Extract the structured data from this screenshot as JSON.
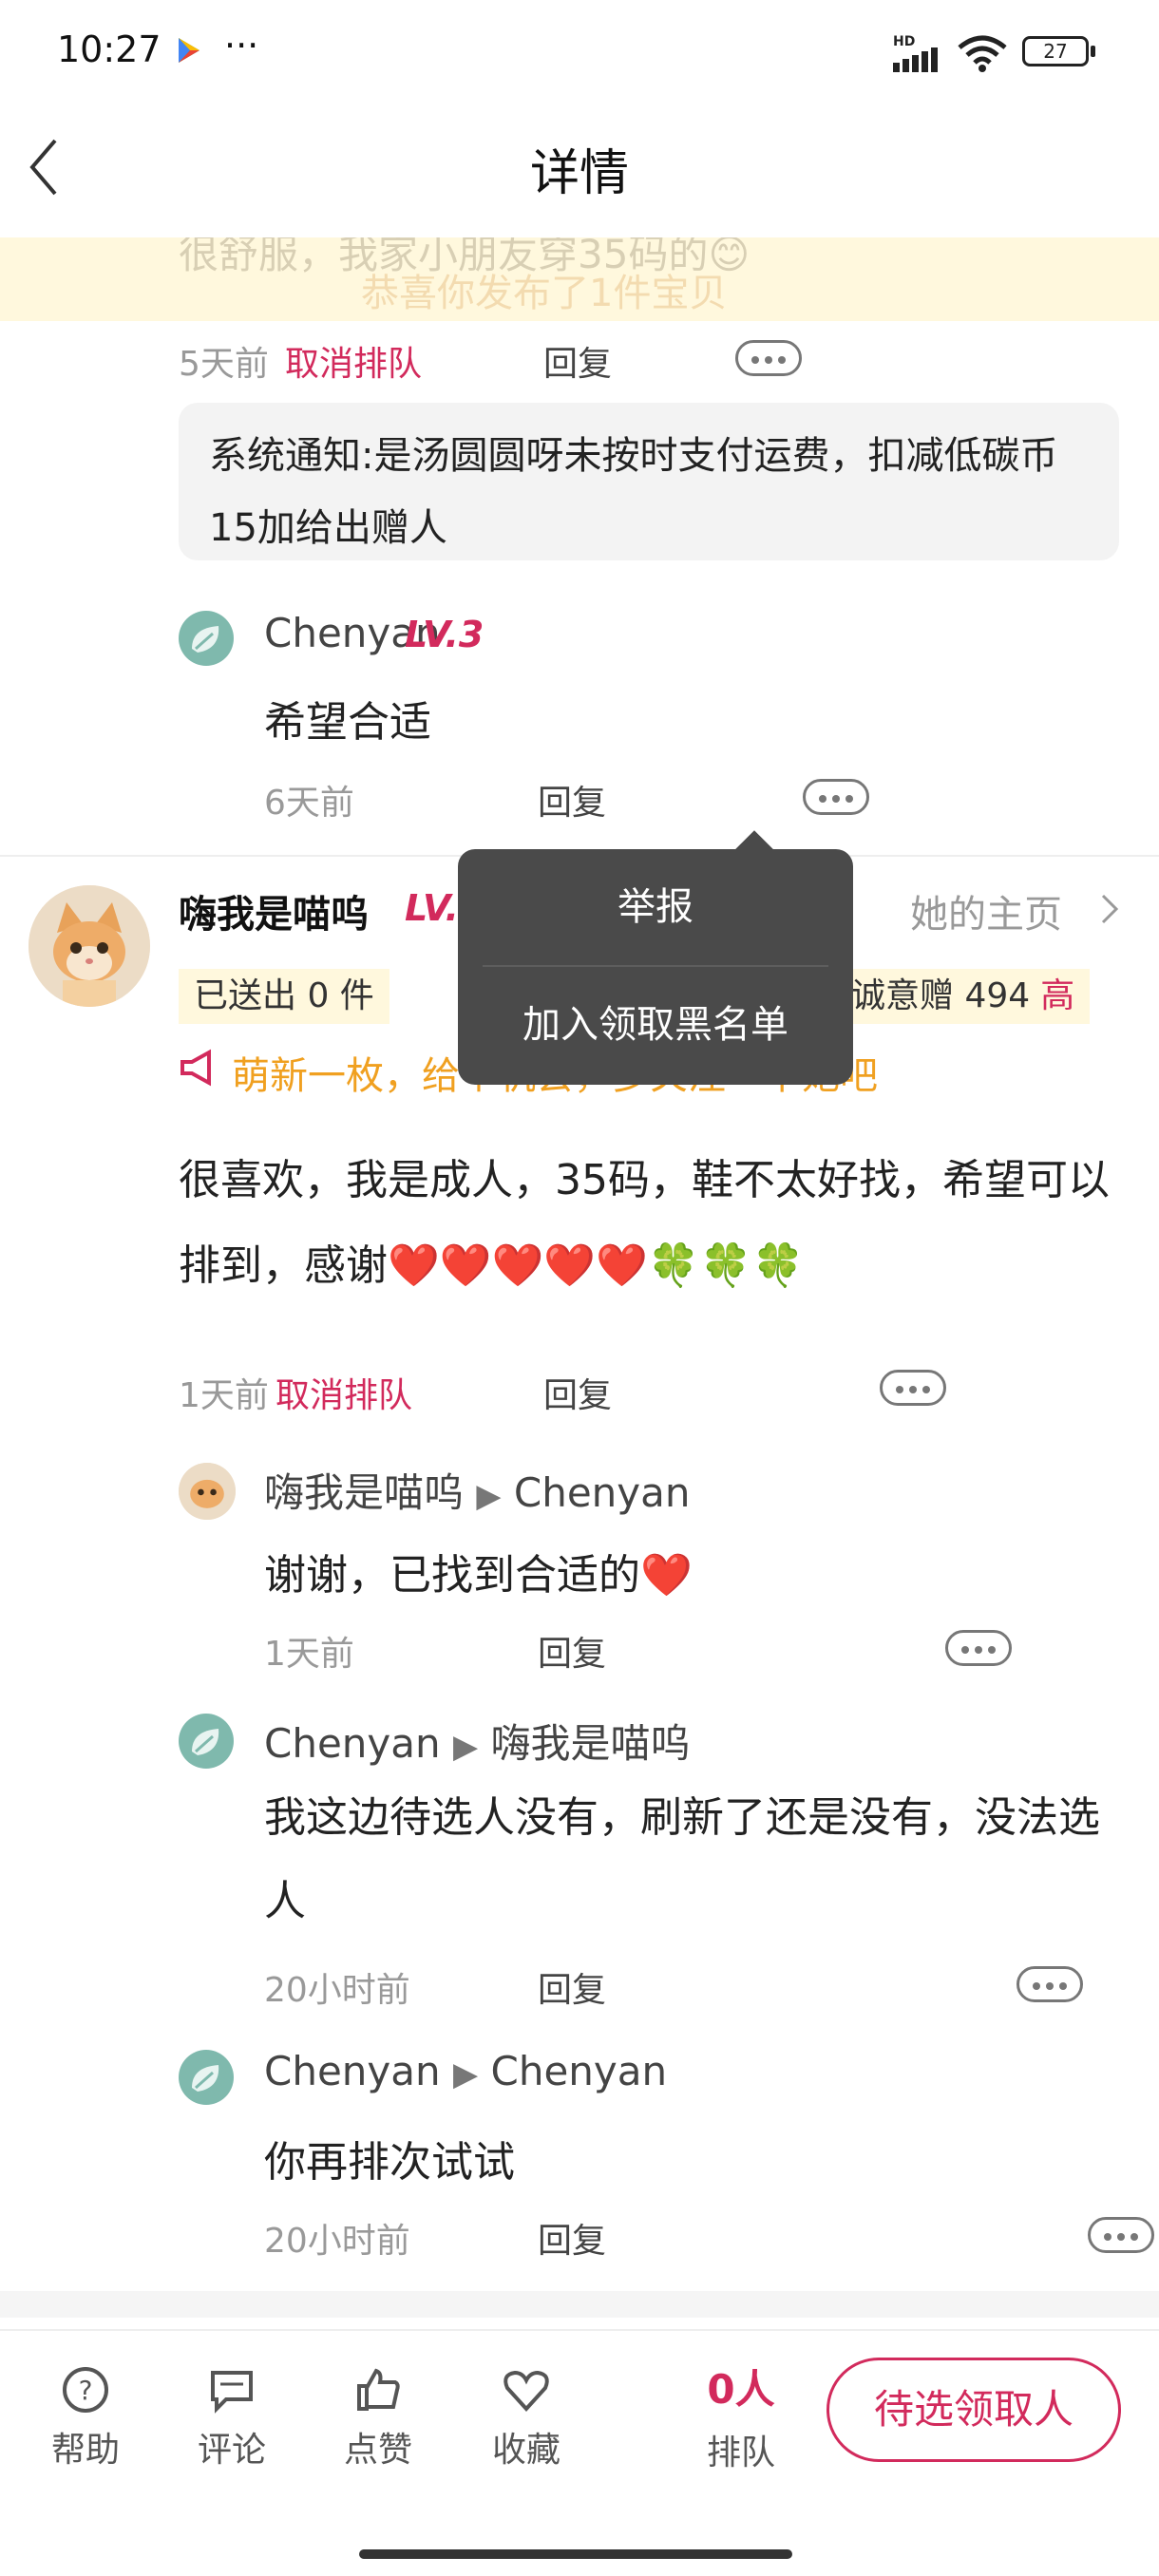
{
  "status_bar": {
    "time": "10:27",
    "dots": "···",
    "network": "HD",
    "battery": "27"
  },
  "header": {
    "title": "详情"
  },
  "banner": {
    "line1": "很舒服，我家小朋友穿35码的😊",
    "line2": "恭喜你发布了1件宝贝"
  },
  "thread1": {
    "time": "5天前",
    "cancel": "取消排队",
    "reply": "回复",
    "notice": "系统通知:是汤圆圆呀未按时支付运费，扣减低碳币15加给出赠人",
    "sub": {
      "user": "Chenyan",
      "level": "LV.3",
      "text": "希望合适",
      "time": "6天前",
      "reply": "回复"
    }
  },
  "popup": {
    "items": [
      "举报",
      "加入领取黑名单"
    ]
  },
  "comment2": {
    "user": "嗨我是喵呜",
    "level": "LV.",
    "homepage": "她的主页",
    "sent": "已送出 0 件",
    "sincerity_label": "诚意赠 494",
    "sincerity_level": "高",
    "tag": "萌新一枚，给个机会，多关注一下她吧",
    "text": "很喜欢，我是成人，35码，鞋不太好找，希望可以排到，感谢❤️❤️❤️❤️❤️🍀🍀🍀",
    "time": "1天前",
    "cancel": "取消排队",
    "reply": "回复",
    "replies": [
      {
        "from": "嗨我是喵呜",
        "to": "Chenyan",
        "text": "谢谢，已找到合适的❤️",
        "time": "1天前",
        "reply": "回复"
      },
      {
        "from": "Chenyan",
        "to": "嗨我是喵呜",
        "text": "我这边待选人没有，刷新了还是没有，没法选人",
        "time": "20小时前",
        "reply": "回复"
      },
      {
        "from": "Chenyan",
        "to": "Chenyan",
        "text": "你再排次试试",
        "time": "20小时前",
        "reply": "回复"
      }
    ]
  },
  "bottom_bar": {
    "help": "帮助",
    "comment": "评论",
    "like": "点赞",
    "fav": "收藏",
    "queue_count": "0人",
    "queue": "排队",
    "cta": "待选领取人"
  },
  "colors": {
    "accent": "#d22a5c",
    "orange": "#f0a020",
    "grey": "#999999"
  }
}
